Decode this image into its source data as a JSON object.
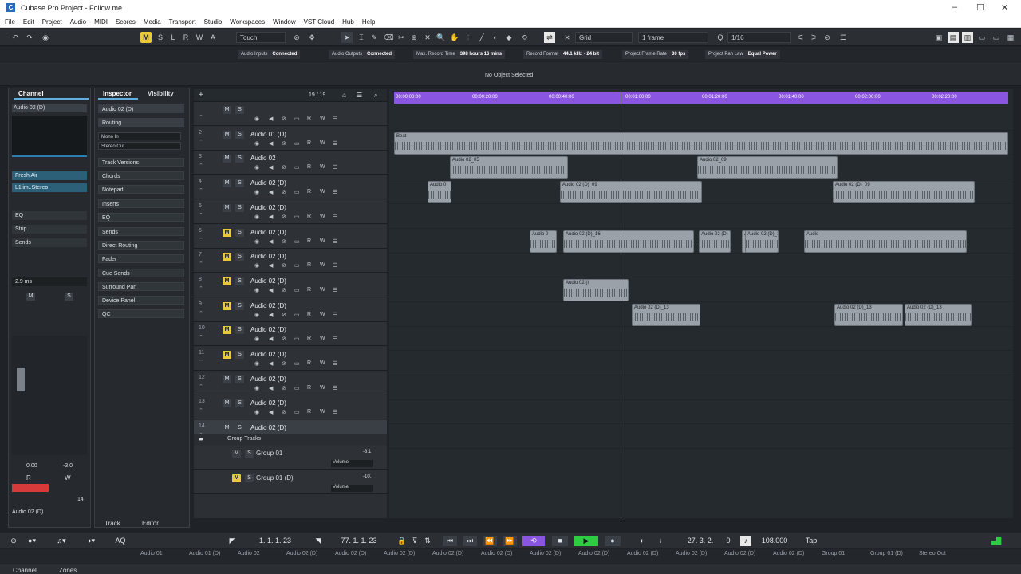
{
  "window": {
    "title": "Cubase Pro Project - Follow me",
    "logo": "C"
  },
  "menu": [
    "File",
    "Edit",
    "Project",
    "Audio",
    "MIDI",
    "Scores",
    "Media",
    "Transport",
    "Studio",
    "Workspaces",
    "Window",
    "VST Cloud",
    "Hub",
    "Help"
  ],
  "toolbar": {
    "mode_buttons": [
      "M",
      "S",
      "L",
      "R",
      "W",
      "A"
    ],
    "automation_mode": "Touch",
    "snap_type": "Grid",
    "grid_size": "1 frame",
    "quantize": "1/16"
  },
  "status": {
    "audio_inputs_label": "Audio Inputs",
    "audio_inputs": "Connected",
    "audio_outputs_label": "Audio Outputs",
    "audio_outputs": "Connected",
    "max_record_label": "Max. Record Time",
    "max_record": "398 hours 16 mins",
    "record_format_label": "Record Format",
    "record_format": "44.1 kHz - 24 bit",
    "frame_rate_label": "Project Frame Rate",
    "frame_rate": "30 fps",
    "pan_law_label": "Project Pan Law",
    "pan_law": "Equal Power",
    "selection": "No Object Selected"
  },
  "channel": {
    "tabs": [
      "Channel"
    ],
    "name": "Audio 02 (D)",
    "inserts": [
      "Fresh Air",
      "L1lim..Stereo"
    ],
    "sections": [
      "EQ",
      "Strip",
      "Sends"
    ],
    "latency": "2.9 ms",
    "ms": [
      "M",
      "S"
    ],
    "vol": "0.00",
    "pan": "-3.0",
    "rw": [
      "R",
      "W"
    ],
    "bottom_name": "Audio 02 (D)",
    "num": "14"
  },
  "inspector": {
    "tabs": [
      "Inspector",
      "Visibility"
    ],
    "track_name": "Audio 02 (D)",
    "routing": "Routing",
    "input": "Mono In",
    "output": "Stereo Out",
    "sections": [
      "Track Versions",
      "Chords",
      "Notepad",
      "Inserts",
      "EQ",
      "Sends",
      "Direct Routing",
      "Fader",
      "Cue Sends",
      "Surround Pan",
      "Device Panel",
      "QC"
    ]
  },
  "bottom_tabs": {
    "track": "Track",
    "editor": "Editor"
  },
  "tracklist": {
    "count": "19 / 19",
    "tracks": [
      {
        "num": "",
        "name": "",
        "yel": false
      },
      {
        "num": "2",
        "name": "Audio 01 (D)",
        "yel": false
      },
      {
        "num": "3",
        "name": "Audio 02",
        "yel": false
      },
      {
        "num": "4",
        "name": "Audio 02 (D)",
        "yel": false
      },
      {
        "num": "5",
        "name": "Audio 02 (D)",
        "yel": false
      },
      {
        "num": "6",
        "name": "Audio 02 (D)",
        "yel": true
      },
      {
        "num": "7",
        "name": "Audio 02 (D)",
        "yel": true
      },
      {
        "num": "8",
        "name": "Audio 02 (D)",
        "yel": true
      },
      {
        "num": "9",
        "name": "Audio 02 (D)",
        "yel": true
      },
      {
        "num": "10",
        "name": "Audio 02 (D)",
        "yel": true
      },
      {
        "num": "11",
        "name": "Audio 02 (D)",
        "yel": true
      },
      {
        "num": "12",
        "name": "Audio 02 (D)",
        "yel": false
      },
      {
        "num": "13",
        "name": "Audio 02 (D)",
        "yel": false
      },
      {
        "num": "14",
        "name": "Audio 02 (D)",
        "yel": false
      }
    ],
    "group_folder": "Group Tracks",
    "groups": [
      {
        "name": "Group 01",
        "param": "Volume",
        "val": "-3.1"
      },
      {
        "name": "Group 01 (D)",
        "param": "Volume",
        "val": "-10."
      }
    ]
  },
  "ruler": [
    "00:00:00:00",
    "00:00:20:00",
    "00:00:40:00",
    "00:01:00:00",
    "00:01:20:00",
    "00:01:40:00",
    "00:02:00:00",
    "00:02:20:00"
  ],
  "clips": [
    {
      "lane": 1,
      "label": "Beat"
    },
    {
      "lane": 2,
      "label": "Audio 02_05"
    },
    {
      "lane": 2,
      "label": "Audio 02_09"
    },
    {
      "lane": 3,
      "label": "Audio 0"
    },
    {
      "lane": 3,
      "label": "Audio 02 (D)_09"
    },
    {
      "lane": 3,
      "label": "Audio 02 (D)_09"
    },
    {
      "lane": 5,
      "label": "Audio 0"
    },
    {
      "lane": 5,
      "label": "Audio 02 (D)_16"
    },
    {
      "lane": 5,
      "label": "Audio 02 (D)"
    },
    {
      "lane": 5,
      "label": "Audio 02"
    },
    {
      "lane": 5,
      "label": "Audio"
    },
    {
      "lane": 5,
      "label": "Audio 02 (D)_16"
    },
    {
      "lane": 7,
      "label": "Audio 02 (I"
    },
    {
      "lane": 8,
      "label": "Audio 02 (D)_13"
    },
    {
      "lane": 8,
      "label": "Audio 02 (D)_13"
    },
    {
      "lane": 8,
      "label": "Audio 02 (D)_13"
    },
    {
      "lane": 8,
      "label": "Audio 02 (D)_13"
    }
  ],
  "transport": {
    "left_locator": "1. 1. 1. 23",
    "right_locator": "77. 1. 1. 23",
    "position": "27. 3. 2.",
    "position_sub": "0",
    "tempo": "108.000",
    "tap": "Tap",
    "aq": "AQ"
  },
  "mixer_channels": [
    "Audio 01",
    "Audio 01 (D)",
    "Audio 02",
    "Audio 02 (D)",
    "Audio 02 (D)",
    "Audio 02 (D)",
    "Audio 02 (D)",
    "Audio 02 (D)",
    "Audio 02 (D)",
    "Audio 02 (D)",
    "Audio 02 (D)",
    "Audio 02 (D)",
    "Audio 02 (D)",
    "Audio 02 (D)",
    "Group 01",
    "Group 01 (D)",
    "Stereo Out"
  ],
  "footer_tabs": [
    "Channel",
    "Zones"
  ],
  "colors": {
    "accent": "#e8c93a",
    "ruler": "#8a55e0",
    "record": "#d63a3a",
    "play": "#2ecc40"
  }
}
